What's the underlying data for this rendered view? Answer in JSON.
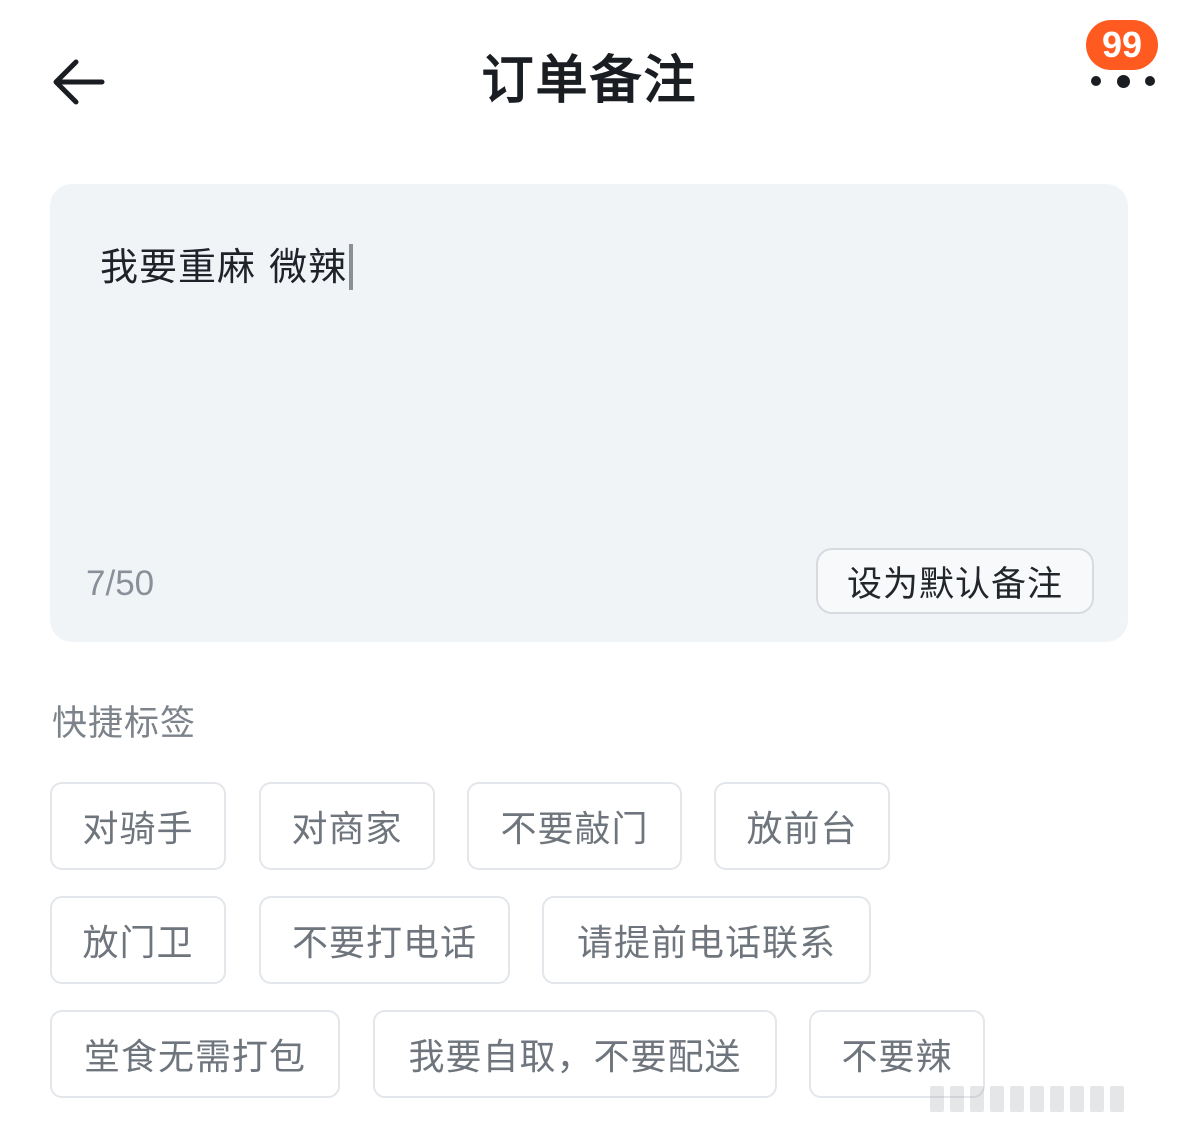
{
  "header": {
    "title": "订单备注",
    "badge_count": "99"
  },
  "note": {
    "text": "我要重麻 微辣",
    "char_count": "7/50",
    "set_default_label": "设为默认备注"
  },
  "quick_tags": {
    "label": "快捷标签",
    "tags": [
      "对骑手",
      "对商家",
      "不要敲门",
      "放前台",
      "放门卫",
      "不要打电话",
      "请提前电话联系",
      "堂食无需打包",
      "我要自取，不要配送",
      "不要辣"
    ]
  },
  "colors": {
    "badge": "#ff5a1f",
    "card_bg": "#f1f4f7",
    "tag_border": "#e3e6ea"
  },
  "icons": {
    "back": "arrow-left-icon",
    "more": "more-dots-icon"
  }
}
